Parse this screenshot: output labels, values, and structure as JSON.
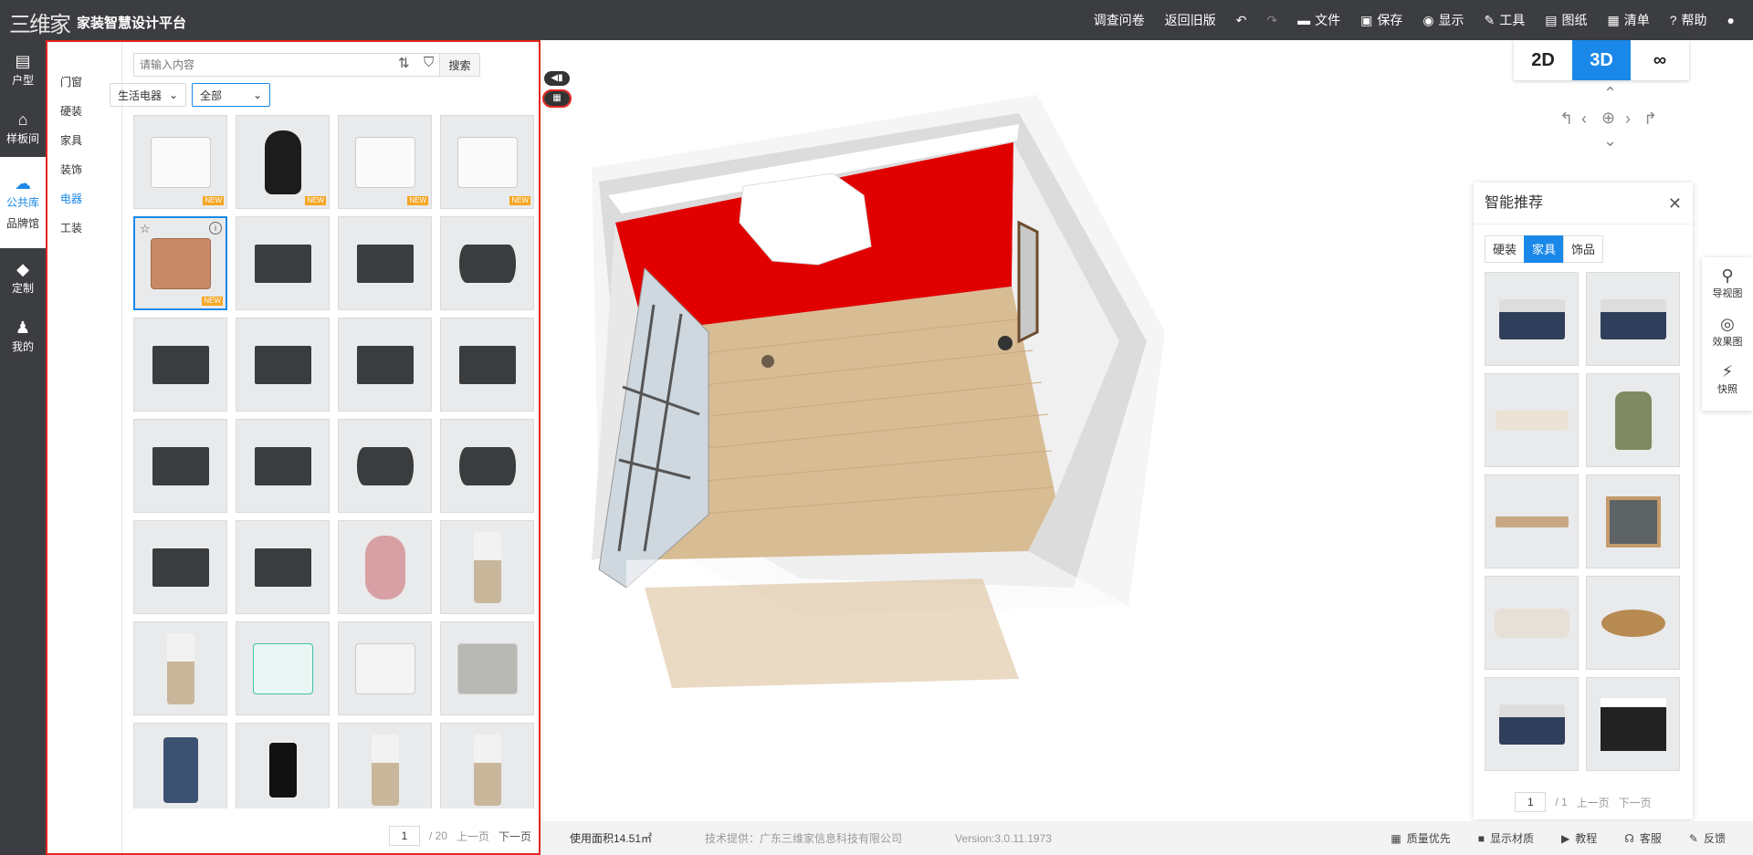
{
  "header": {
    "logo_text": "三维家",
    "title": "家装智慧设计平台",
    "menu": [
      {
        "icon": "none",
        "label": "调查问卷"
      },
      {
        "icon": "none",
        "label": "返回旧版"
      },
      {
        "icon": "undo-icon",
        "label": ""
      },
      {
        "icon": "redo-icon",
        "label": ""
      },
      {
        "icon": "folder-icon",
        "label": "文件"
      },
      {
        "icon": "save-icon",
        "label": "保存"
      },
      {
        "icon": "eye-icon",
        "label": "显示"
      },
      {
        "icon": "wrench-icon",
        "label": "工具"
      },
      {
        "icon": "map-icon",
        "label": "图纸"
      },
      {
        "icon": "list-icon",
        "label": "清单"
      },
      {
        "icon": "help-icon",
        "label": "帮助"
      },
      {
        "icon": "user-icon",
        "label": ""
      }
    ]
  },
  "leftnav": {
    "items": [
      {
        "icon": "floorplan-icon",
        "label": "户型"
      },
      {
        "icon": "house-icon",
        "label": "样板间"
      },
      {
        "icon": "cloud-icon",
        "label": "公共库",
        "sub": "品牌馆",
        "active": true
      },
      {
        "icon": "shapes-icon",
        "label": "定制"
      },
      {
        "icon": "person-icon",
        "label": "我的"
      }
    ]
  },
  "panel": {
    "categories": [
      "门窗",
      "硬装",
      "家具",
      "装饰",
      "电器",
      "工装"
    ],
    "active_category": "电器",
    "search": {
      "placeholder": "请输入内容",
      "button": "搜索"
    },
    "filter1": "生活电器",
    "filter2": "全部",
    "items": [
      {
        "kind": "box",
        "badge": "NEW"
      },
      {
        "kind": "purifier",
        "badge": "NEW"
      },
      {
        "kind": "box",
        "badge": "NEW"
      },
      {
        "kind": "box",
        "badge": "NEW"
      },
      {
        "kind": "freezer",
        "badge": "NEW",
        "selected": true
      },
      {
        "kind": "tv"
      },
      {
        "kind": "tv"
      },
      {
        "kind": "tvc"
      },
      {
        "kind": "tv"
      },
      {
        "kind": "tv"
      },
      {
        "kind": "tv"
      },
      {
        "kind": "tv"
      },
      {
        "kind": "tv"
      },
      {
        "kind": "tv"
      },
      {
        "kind": "tvc"
      },
      {
        "kind": "tvc"
      },
      {
        "kind": "tv"
      },
      {
        "kind": "tv"
      },
      {
        "kind": "juicer"
      },
      {
        "kind": "dispenser"
      },
      {
        "kind": "dispenser"
      },
      {
        "kind": "teal"
      },
      {
        "kind": "cube"
      },
      {
        "kind": "steel"
      },
      {
        "kind": "blue"
      },
      {
        "kind": "black"
      },
      {
        "kind": "dispenser"
      },
      {
        "kind": "dispenser"
      }
    ],
    "pager": {
      "current": "1",
      "total": "/ 20",
      "prev": "上一页",
      "next": "下一页"
    }
  },
  "view_modes": [
    "2D",
    "3D",
    "VR"
  ],
  "active_mode": "3D",
  "reco": {
    "title": "智能推荐",
    "tabs": [
      "硬装",
      "家具",
      "饰品"
    ],
    "active_tab": "家具",
    "items": [
      "bed",
      "bed",
      "bench",
      "chair",
      "table",
      "nightstand",
      "sofa",
      "round-table",
      "bed",
      "cabinet"
    ],
    "pager": {
      "current": "1",
      "total": "/ 1",
      "prev": "上一页",
      "next": "下一页"
    }
  },
  "side_tools": [
    {
      "icon": "pin-icon",
      "label": "导视图"
    },
    {
      "icon": "camera-icon",
      "label": "效果图"
    },
    {
      "icon": "flash-icon",
      "label": "快照"
    }
  ],
  "status": {
    "area": "使用面积14.51㎡",
    "provider": "技术提供：广东三维家信息科技有限公司",
    "version": "Version:3.0.11.1973",
    "actions": [
      "质量优先",
      "显示材质",
      "教程",
      "客服",
      "反馈"
    ]
  },
  "colors": {
    "accent": "#1a88e8",
    "topbar": "#3c3d41",
    "wall_red": "#e10000",
    "highlight": "#e3261f"
  }
}
